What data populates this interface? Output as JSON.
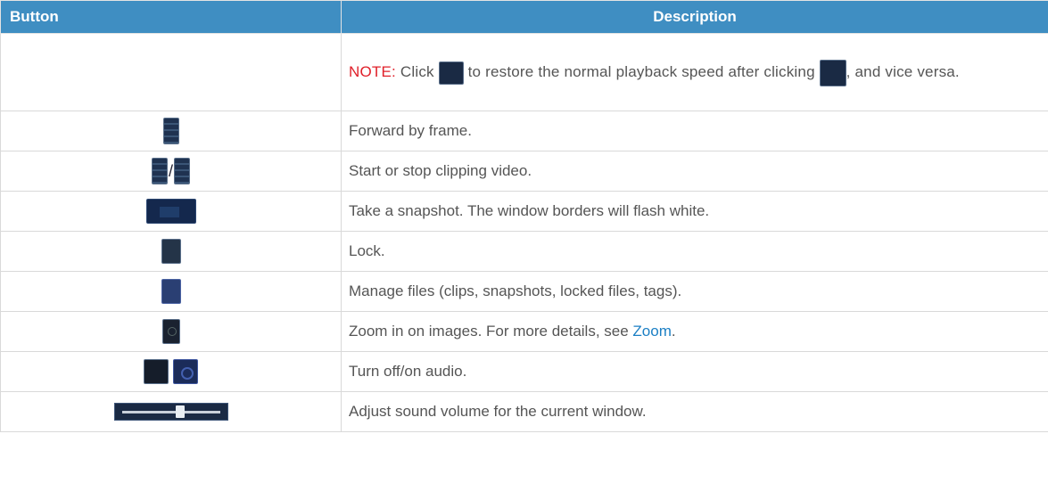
{
  "header": {
    "col_button": "Button",
    "col_description": "Description"
  },
  "colors": {
    "header_bg": "#3f8ec2",
    "note": "#e0202a",
    "link": "#1b7fc4"
  },
  "note_row": {
    "note_label": "NOTE:",
    "text_1": "Click",
    "text_2": "to restore the normal playback speed after clicking",
    "text_3": ", and vice versa.",
    "icon_1": "restore-speed-icon",
    "icon_2": "change-speed-icon"
  },
  "rows": [
    {
      "icon": "forward-frame-icon",
      "description": "Forward by frame."
    },
    {
      "icon": "clip-start-stop-icon",
      "separator": "/",
      "description": "Start or stop clipping video."
    },
    {
      "icon": "snapshot-icon",
      "description": "Take a snapshot. The window borders will flash white."
    },
    {
      "icon": "lock-icon",
      "description": "Lock."
    },
    {
      "icon": "manage-files-icon",
      "description": "Manage files (clips, snapshots, locked files, tags)."
    },
    {
      "icon": "zoom-icon",
      "description_pre": "Zoom in on images. For more details, see ",
      "link": "Zoom",
      "description_post": "."
    },
    {
      "icon": "audio-toggle-icon",
      "description": "Turn off/on audio."
    },
    {
      "icon": "volume-slider-icon",
      "description": "Adjust sound volume for the current window.",
      "volume_level": 0.6
    }
  ]
}
